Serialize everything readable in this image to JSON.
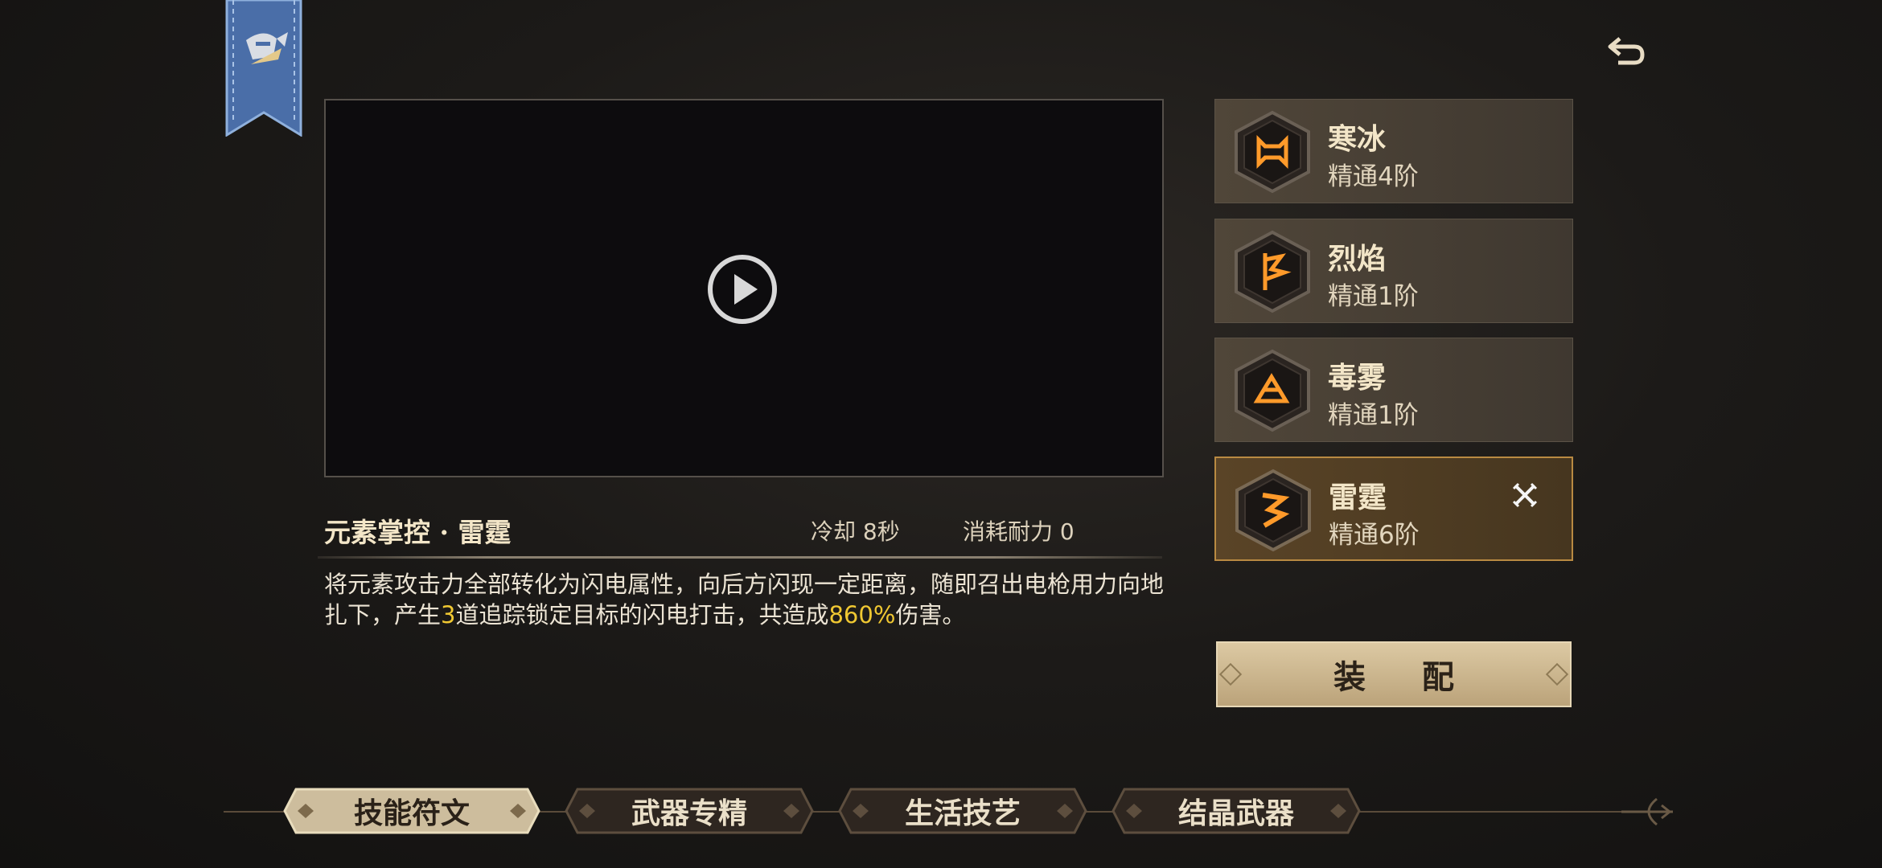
{
  "banner": {
    "icon": "winged-helmet-icon"
  },
  "back_button": {
    "icon": "back-arrow-icon"
  },
  "video": {
    "play_icon": "play-icon"
  },
  "skill": {
    "title": "元素掌控 · 雷霆",
    "cooldown": "冷却 8秒",
    "stamina": "消耗耐力 0",
    "description": {
      "part1": "将元素攻击力全部转化为闪电属性，向后方闪现一定距离，随即召出电枪用力向地扎下，产生",
      "count": "3",
      "part2": "道追踪锁定目标的闪电打击，共造成",
      "percent": "860%",
      "part3": "伤害。"
    }
  },
  "runes": [
    {
      "name": "寒冰",
      "level": "精通4阶",
      "icon": "ice-rune-icon",
      "selected": false
    },
    {
      "name": "烈焰",
      "level": "精通1阶",
      "icon": "fire-rune-icon",
      "selected": false
    },
    {
      "name": "毒雾",
      "level": "精通1阶",
      "icon": "poison-rune-icon",
      "selected": false
    },
    {
      "name": "雷霆",
      "level": "精通6阶",
      "icon": "thunder-rune-icon",
      "selected": true,
      "status_icon": "crossed-swords-icon"
    }
  ],
  "equip_button": {
    "label": "装 配"
  },
  "tabs": [
    {
      "label": "技能符文",
      "active": true
    },
    {
      "label": "武器专精",
      "active": false
    },
    {
      "label": "生活技艺",
      "active": false
    },
    {
      "label": "结晶武器",
      "active": false
    }
  ],
  "colors": {
    "highlight": "#f0c832",
    "selected_border": "#b98a42",
    "rune_glow": "#ff9a2a"
  }
}
